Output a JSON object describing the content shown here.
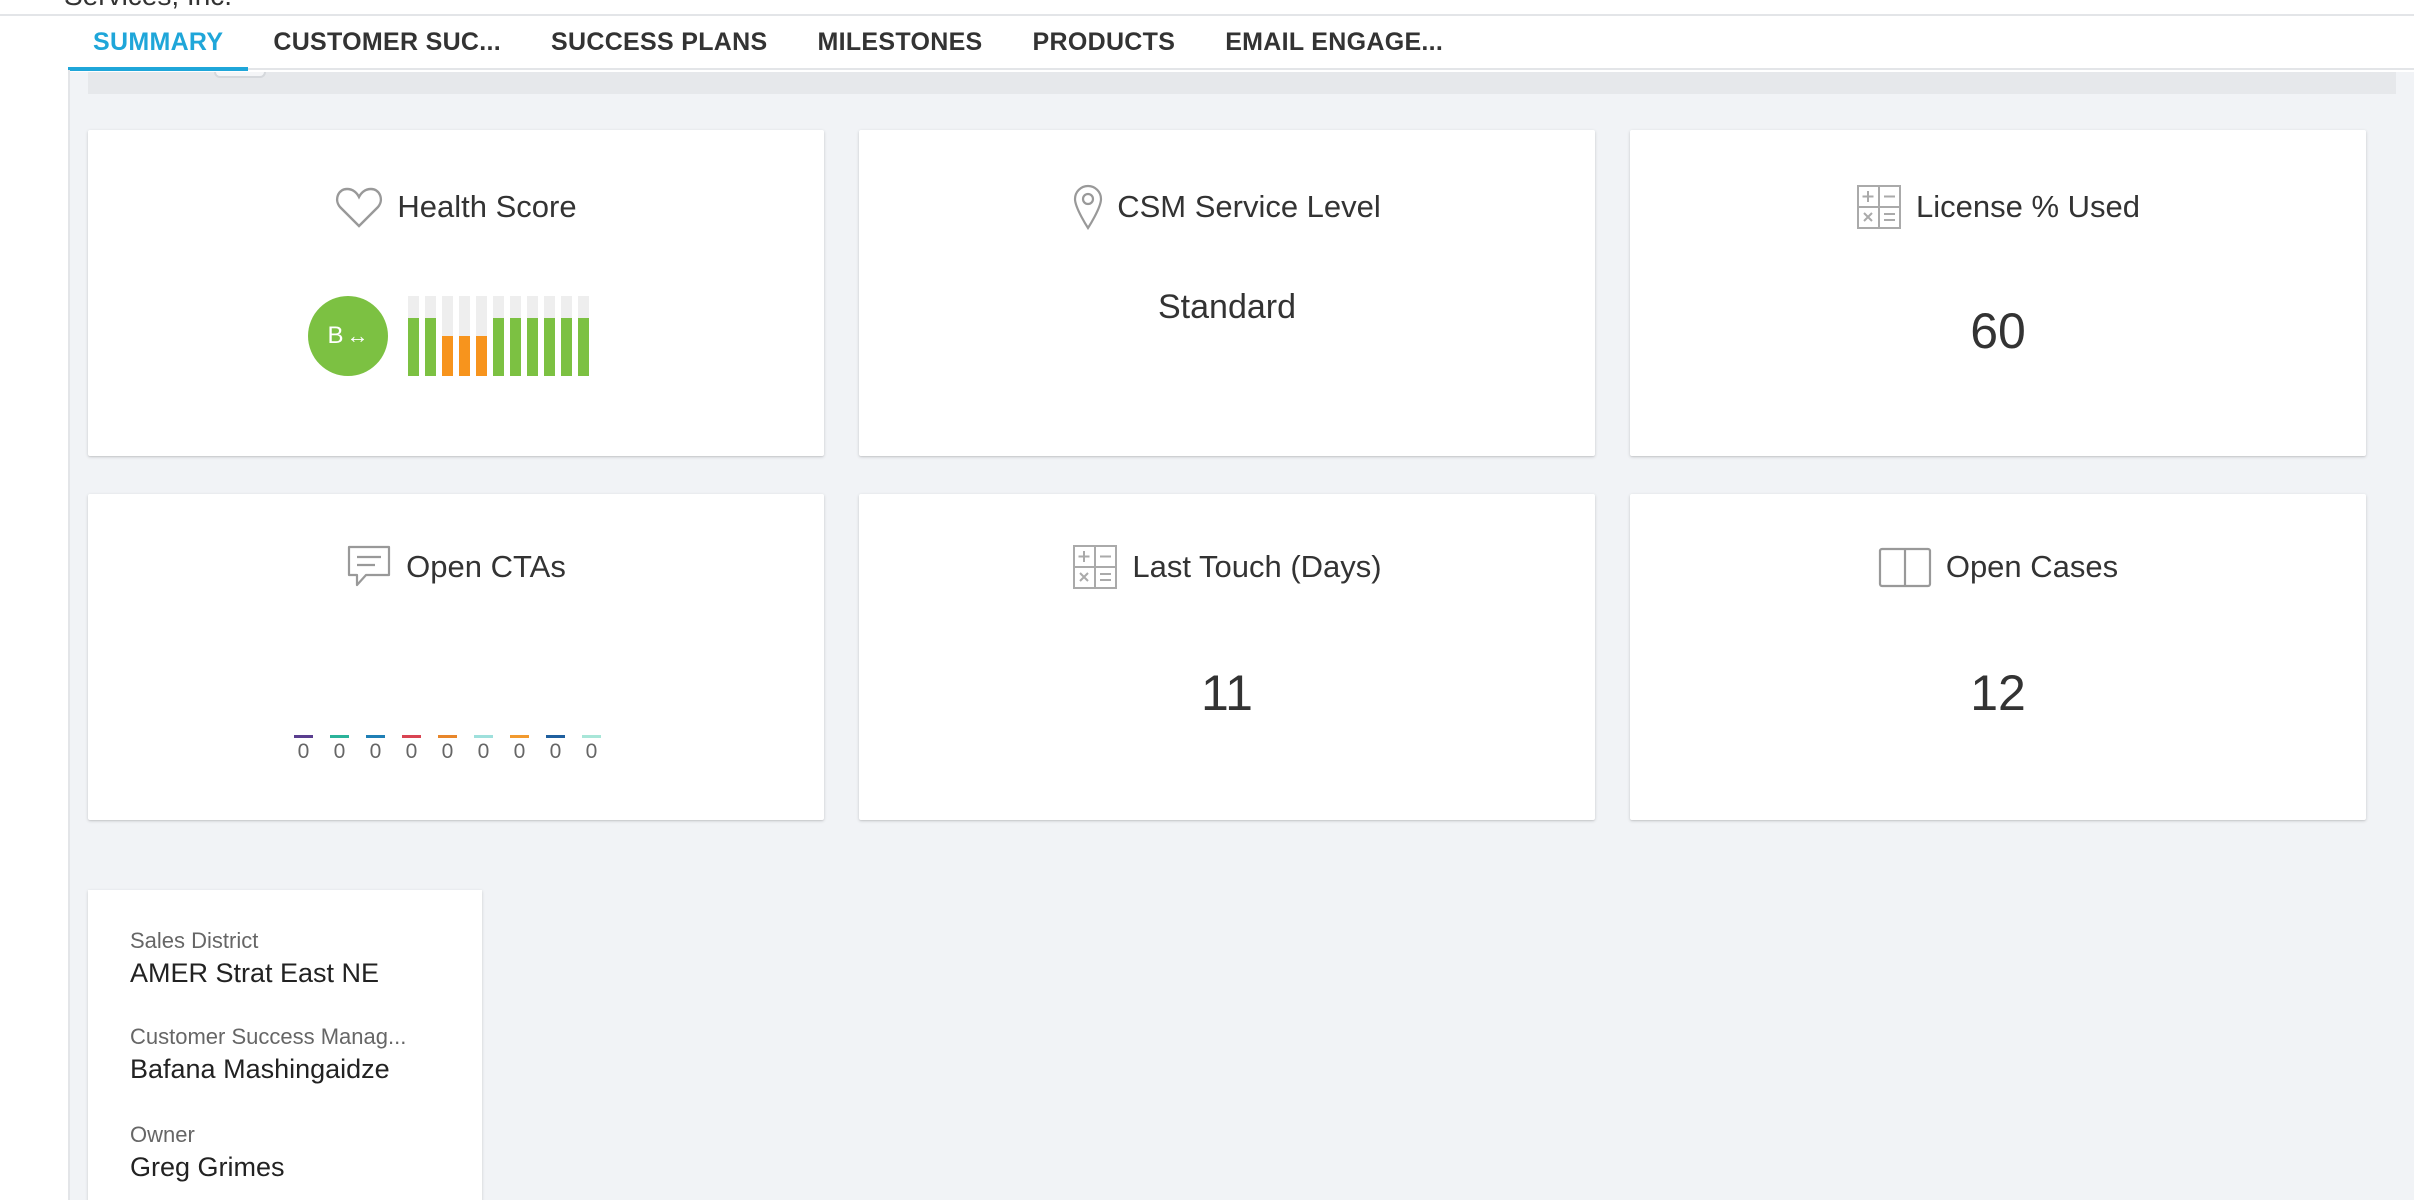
{
  "account": {
    "title_fragment": "Services, Inc."
  },
  "tabs": [
    {
      "label": "SUMMARY",
      "active": true
    },
    {
      "label": "CUSTOMER SUC..."
    },
    {
      "label": "SUCCESS PLANS"
    },
    {
      "label": "MILESTONES"
    },
    {
      "label": "PRODUCTS"
    },
    {
      "label": "EMAIL ENGAGE..."
    }
  ],
  "cards": {
    "health": {
      "title": "Health Score",
      "icon": "heart-icon",
      "grade": "B",
      "trend_symbol": "↔",
      "history": [
        {
          "level": 0.72,
          "color": "#7cc142"
        },
        {
          "level": 0.72,
          "color": "#7cc142"
        },
        {
          "level": 0.5,
          "color": "#f7941d"
        },
        {
          "level": 0.5,
          "color": "#f7941d"
        },
        {
          "level": 0.5,
          "color": "#f7941d"
        },
        {
          "level": 0.72,
          "color": "#7cc142"
        },
        {
          "level": 0.72,
          "color": "#7cc142"
        },
        {
          "level": 0.72,
          "color": "#7cc142"
        },
        {
          "level": 0.72,
          "color": "#7cc142"
        },
        {
          "level": 0.72,
          "color": "#7cc142"
        },
        {
          "level": 0.72,
          "color": "#7cc142"
        }
      ]
    },
    "csm_service_level": {
      "title": "CSM Service Level",
      "icon": "location-pin-icon",
      "value": "Standard"
    },
    "license_used": {
      "title": "License % Used",
      "icon": "calculator-icon",
      "value": "60"
    },
    "open_ctas": {
      "title": "Open CTAs",
      "icon": "chat-bubble-icon",
      "counts": [
        {
          "value": "0",
          "color": "#5a3e8f"
        },
        {
          "value": "0",
          "color": "#2bb39a"
        },
        {
          "value": "0",
          "color": "#1f7fb5"
        },
        {
          "value": "0",
          "color": "#d94452"
        },
        {
          "value": "0",
          "color": "#e8862a"
        },
        {
          "value": "0",
          "color": "#9ee0dc"
        },
        {
          "value": "0",
          "color": "#f29a2e"
        },
        {
          "value": "0",
          "color": "#1f5f9e"
        },
        {
          "value": "0",
          "color": "#a8e6d8"
        }
      ]
    },
    "last_touch": {
      "title": "Last Touch (Days)",
      "icon": "calculator-icon",
      "value": "11"
    },
    "open_cases": {
      "title": "Open Cases",
      "icon": "book-icon",
      "value": "12"
    }
  },
  "attributes": [
    {
      "label": "Sales District",
      "value": "AMER Strat East NE"
    },
    {
      "label": "Customer Success Manag...",
      "value": "Bafana Mashingaidze"
    },
    {
      "label": "Owner",
      "value": "Greg Grimes"
    }
  ],
  "colors": {
    "accent": "#1fa6d9",
    "health_good": "#7cc142",
    "health_warn": "#f7941d",
    "background": "#f1f3f6"
  }
}
